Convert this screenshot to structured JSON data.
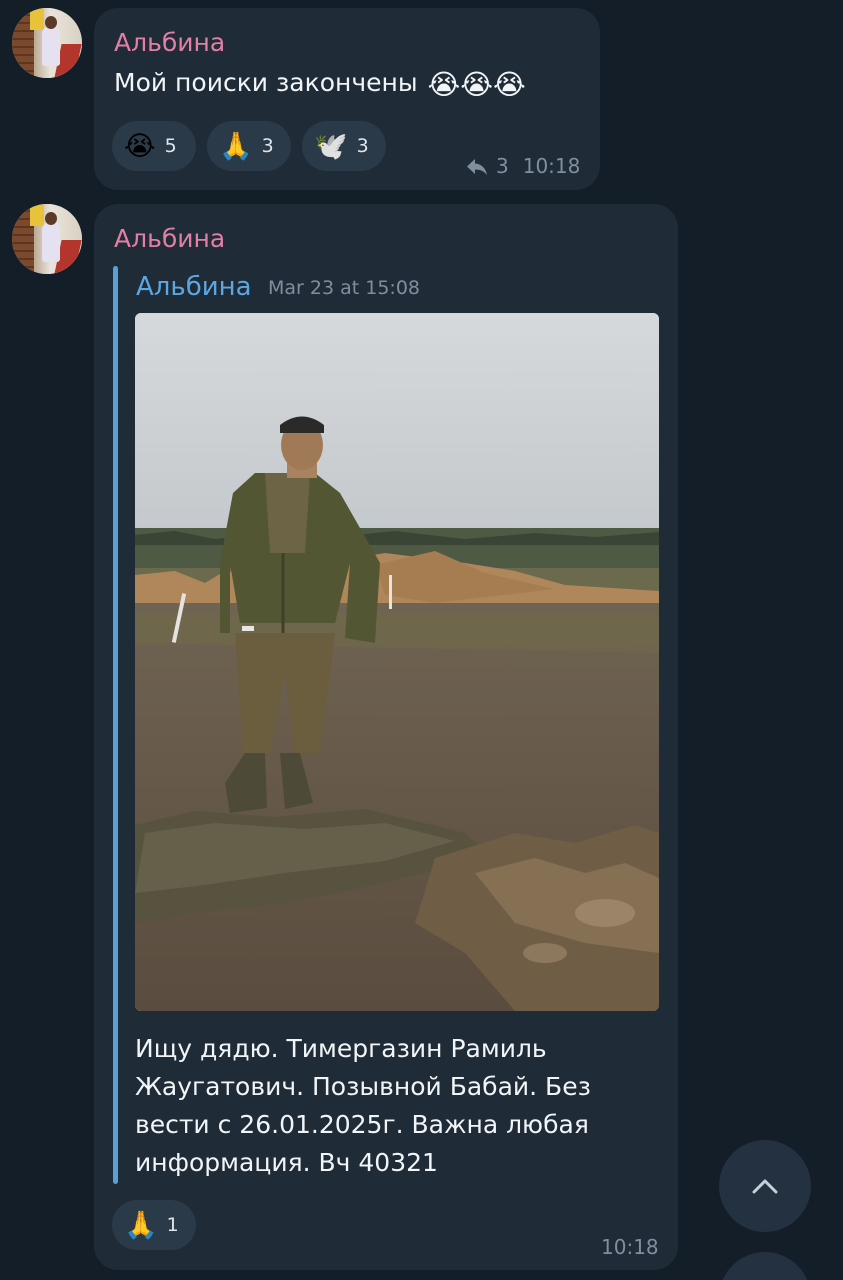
{
  "messages": [
    {
      "sender": "Альбина",
      "text": "Мой поиски закончены",
      "text_emoji": "😭😭😭",
      "reactions": [
        {
          "emoji": "😭",
          "count": "5"
        },
        {
          "emoji": "🙏",
          "count": "3"
        },
        {
          "emoji": "🕊️",
          "count": "3"
        }
      ],
      "reply_count": "3",
      "time": "10:18"
    },
    {
      "sender": "Альбина",
      "forwarded": {
        "name": "Альбина",
        "date": "Mar 23 at 15:08"
      },
      "caption": "Ищу дядю. Тимергазин Рамиль Жаугатович.  Позывной Бабай. Без вести с 26.01.2025г.  Важна любая информация. Вч 40321",
      "reactions": [
        {
          "emoji": "🙏",
          "count": "1"
        }
      ],
      "time": "10:18"
    }
  ],
  "icons": {
    "reply": "reply-arrow-icon",
    "scroll_up": "chevron-up-icon"
  },
  "colors": {
    "background": "#141e29",
    "bubble": "#1f2b37",
    "sender": "#e37fa6",
    "forward_name": "#5ea6e0",
    "meta": "#7f8f9e"
  }
}
